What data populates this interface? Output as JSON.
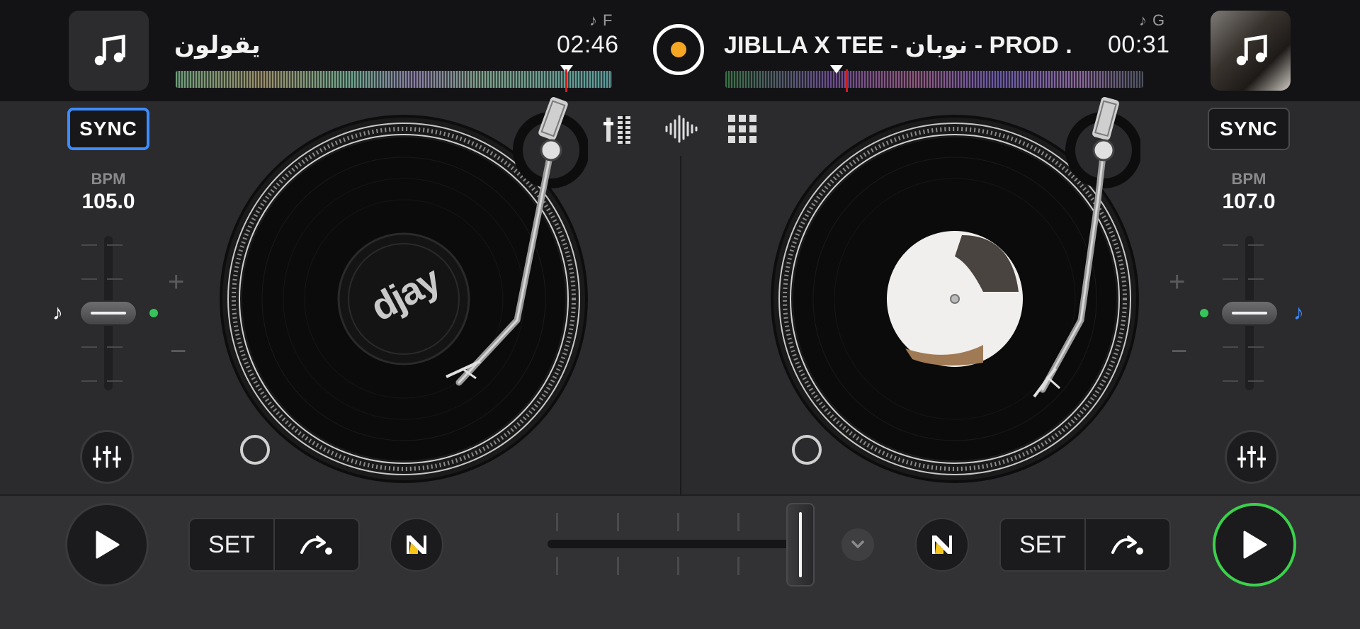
{
  "colors": {
    "background": "#2b2b2e",
    "topbar": "#131315",
    "sync_active_border": "#3d8cff",
    "play_active_ring": "#3bd14a",
    "record_dot": "#f5a623",
    "playhead": "#d11b1b",
    "pitch_indicator": "#35c55a",
    "note_right": "#3d8cff"
  },
  "header": {
    "record_icon": "record-icon"
  },
  "deck_a": {
    "art_icon": "music-note-icon",
    "title": "يقولون",
    "time": "02:46",
    "key": "F",
    "sync_label": "SYNC",
    "bpm_label": "BPM",
    "bpm": "105.0",
    "pitch_plus": "+",
    "pitch_minus": "−",
    "label_text": "djay",
    "set_label": "SET",
    "play_icon": "play-icon",
    "eq_icon": "eq-sliders-icon",
    "jump_icon": "cue-jump-icon",
    "neural_icon": "neural-mix-icon"
  },
  "deck_b": {
    "art_icon": "music-note-icon",
    "title": "JIBLLA X TEE - نوبان - PROD ...",
    "time": "00:31",
    "key": "G",
    "sync_label": "SYNC",
    "bpm_label": "BPM",
    "bpm": "107.0",
    "pitch_plus": "+",
    "pitch_minus": "−",
    "set_label": "SET",
    "play_icon": "play-icon",
    "eq_icon": "eq-sliders-icon",
    "jump_icon": "cue-jump-icon",
    "neural_icon": "neural-mix-icon"
  },
  "toolbar": {
    "mixer_icon": "mixer-icon",
    "waveform_icon": "waveform-icon",
    "grid_icon": "pads-grid-icon"
  },
  "crossfader": {
    "position": 0.95,
    "expand_icon": "chevron-down-icon"
  }
}
